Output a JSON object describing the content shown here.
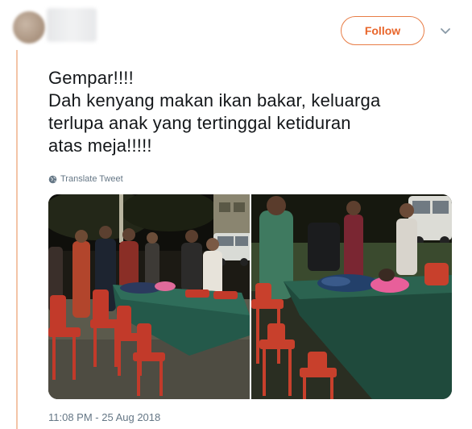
{
  "tweet": {
    "follow_label": "Follow",
    "text_lines": [
      "Gempar!!!!",
      "Dah kenyang makan ikan bakar, keluarga",
      "terlupa anak yang tertinggal ketiduran",
      "atas meja!!!!!"
    ],
    "translate_label": "Translate Tweet",
    "timestamp": "11:08 PM - 25 Aug 2018"
  },
  "colors": {
    "accent": "#e8652a",
    "thread_line": "#f3c4a7",
    "meta_text": "#657786"
  },
  "icons": {
    "more_menu": "chevron-down-icon",
    "translate": "globe-icon"
  }
}
